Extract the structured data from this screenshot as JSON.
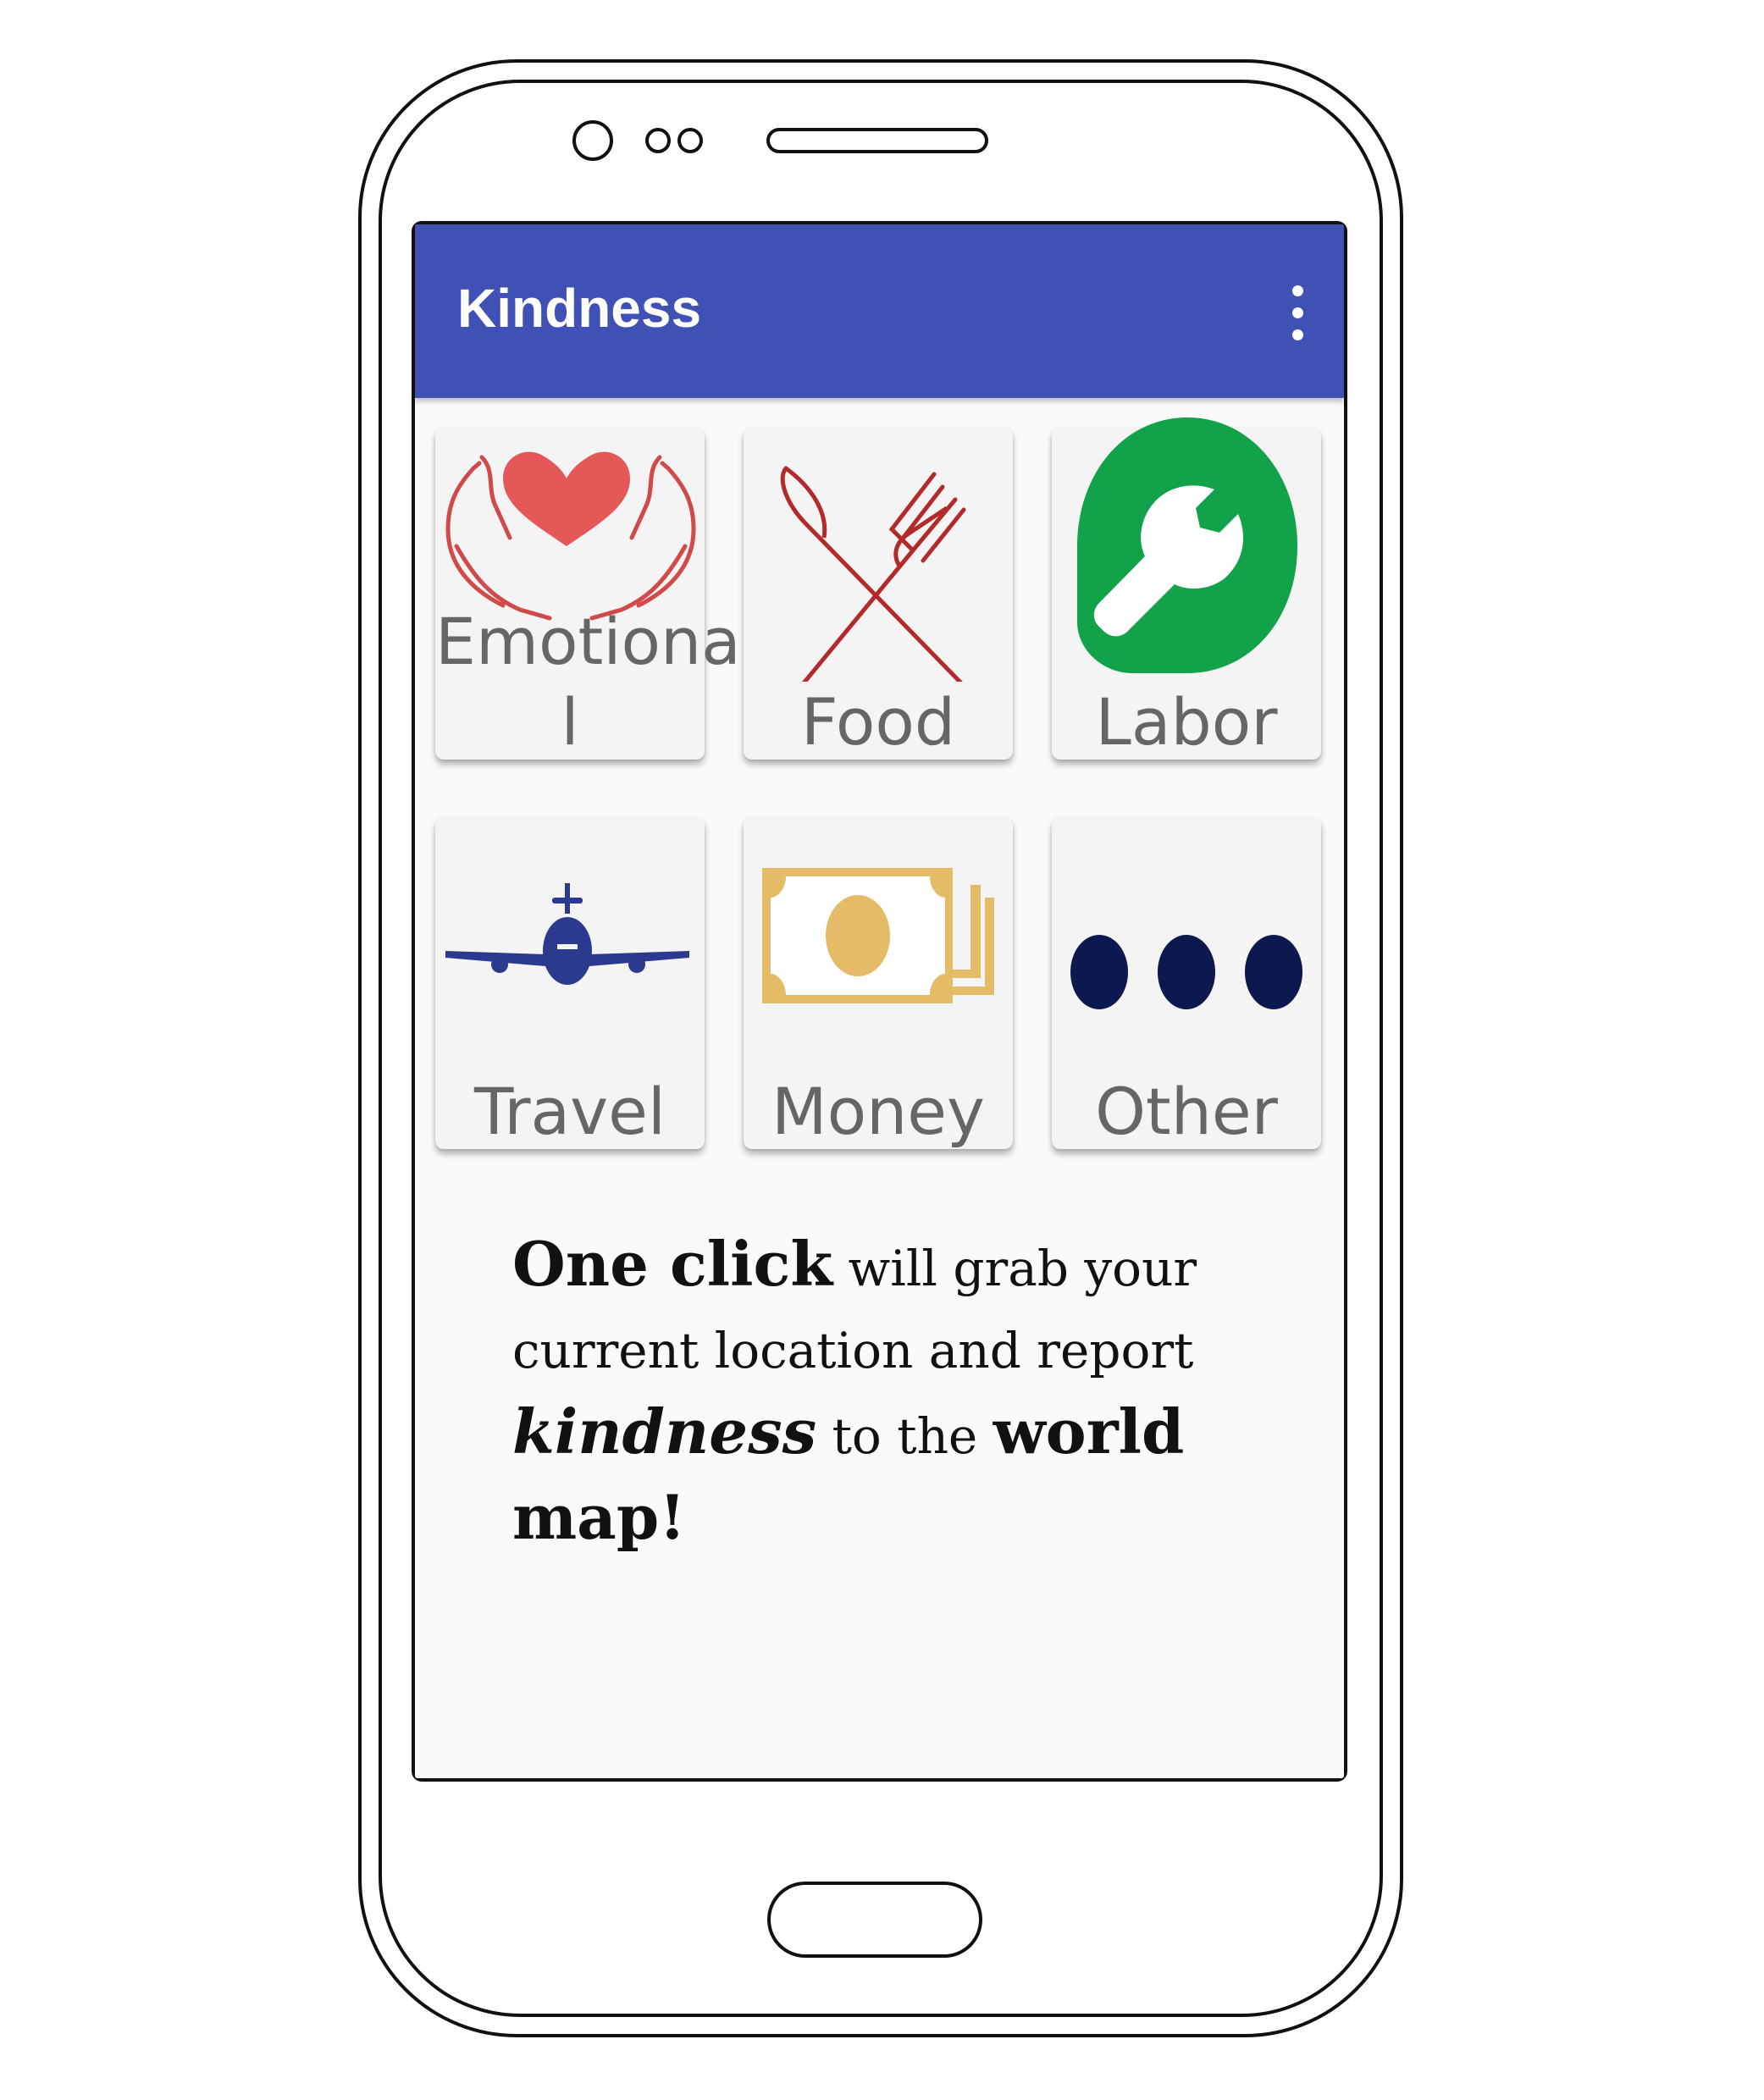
{
  "app": {
    "title": "Kindness"
  },
  "toolbar": {
    "overflow_icon": "more-vert-icon"
  },
  "categories": [
    {
      "label": "Emotional",
      "icon": "heart-hands-icon"
    },
    {
      "label": "Food",
      "icon": "fork-knife-icon"
    },
    {
      "label": "Labor",
      "icon": "wrench-icon"
    },
    {
      "label": "Travel",
      "icon": "airplane-icon"
    },
    {
      "label": "Money",
      "icon": "money-icon"
    },
    {
      "label": "Other",
      "icon": "more-dots-icon"
    }
  ],
  "emotional_label_lines": [
    "Emotiona",
    "l"
  ],
  "message": {
    "part1": "One click",
    "part2": " will grab your",
    "part3": "current location and report",
    "part4": "kindness",
    "part5": " to the ",
    "part6": "world map!"
  },
  "colors": {
    "appbar": "#3f51b5",
    "heart": "#e55858",
    "utensils": "#b22a2a",
    "labor": "#12a249",
    "airplane": "#2b3a8f",
    "money": "#e4bb66",
    "dots": "#0d1850"
  }
}
